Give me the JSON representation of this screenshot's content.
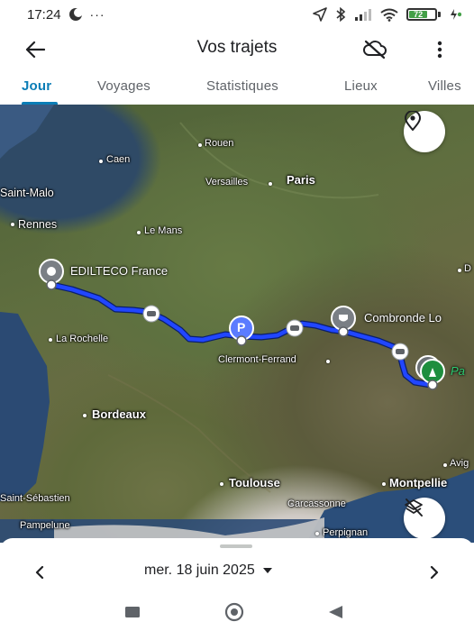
{
  "status_bar": {
    "time": "17:24",
    "more_indicator": "···",
    "battery_level": "72",
    "icons": [
      "moon-icon",
      "location-arrow-icon",
      "bluetooth-icon",
      "signal-icon",
      "wifi-icon",
      "battery-icon",
      "charging-icon"
    ]
  },
  "app_bar": {
    "title": "Vos trajets",
    "back_icon": "arrow-left-icon",
    "hide_icon": "cloud-off-icon",
    "more_icon": "more-vert-icon"
  },
  "tabs": [
    {
      "label": "Jour",
      "active": true
    },
    {
      "label": "Voyages",
      "active": false
    },
    {
      "label": "Statistiques",
      "active": false
    },
    {
      "label": "Lieux",
      "active": false
    },
    {
      "label": "Villes",
      "active": false
    }
  ],
  "colors": {
    "accent": "#0b7db6",
    "route": "#1a3cff"
  },
  "map": {
    "labels": {
      "rouen": "Rouen",
      "caen": "Caen",
      "paris": "Paris",
      "versailles": "Versailles",
      "saint_malo": "Saint-Malo",
      "rennes": "Rennes",
      "le_mans": "Le Mans",
      "la_rochelle": "La Rochelle",
      "clermont": "Clermont-Ferrand",
      "bordeaux": "Bordeaux",
      "toulouse": "Toulouse",
      "montpellier": "Montpellie",
      "carcassonne": "Carcassonne",
      "perpignan": "Perpignan",
      "saint_sebastien": "Saint-Sébastien",
      "pampelune": "Pampelune",
      "avig": "Avig",
      "d_edge": "D",
      "pa_edge": "Pa"
    },
    "places": {
      "start": "EDILTECO France",
      "mid": "Combronde Lo"
    },
    "parking_letter": "P",
    "locate_icon": "location-pin-icon",
    "layers_icon": "layers-off-icon"
  },
  "bottom_sheet": {
    "date": "mer. 18 juin 2025",
    "prev_icon": "chevron-left-icon",
    "next_icon": "chevron-right-icon",
    "dropdown_icon": "caret-down-icon"
  },
  "nav_bar": {
    "recents_icon": "square-icon",
    "home_icon": "circle-icon",
    "back_icon": "triangle-back-icon"
  }
}
